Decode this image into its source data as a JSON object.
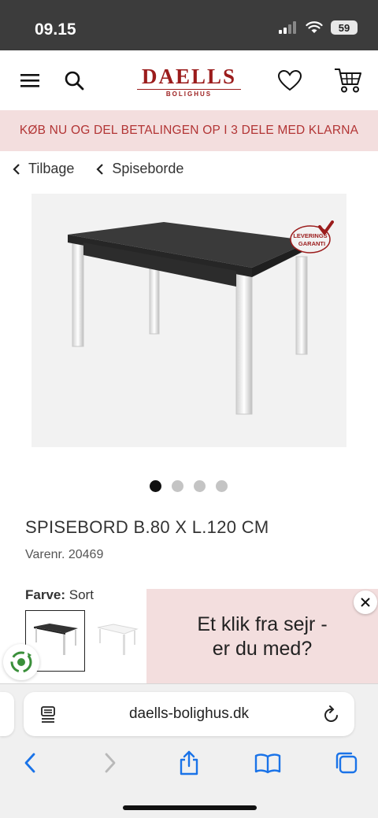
{
  "status_bar": {
    "time": "09.15",
    "battery": "59"
  },
  "header": {
    "logo_main": "DAELLS",
    "logo_sub": "BOLIGHUS",
    "icons": [
      "menu-icon",
      "search-icon",
      "heart-icon",
      "cart-icon"
    ]
  },
  "promo_banner": {
    "text": "KØB NU OG DEL BETALINGEN OP I 3 DELE MED KLARNA"
  },
  "breadcrumbs": [
    {
      "label": "Tilbage"
    },
    {
      "label": "Spiseborde"
    }
  ],
  "product": {
    "badge_line1": "LEVERINGS",
    "badge_line2": "GARANTI",
    "image_count": 4,
    "active_image": 1,
    "title": "SPISEBORD B.80 X L.120 CM",
    "sku": "Varenr. 20469",
    "color_label": "Farve:",
    "color_value": "Sort",
    "swatches": [
      "Sort",
      "Hvid"
    ]
  },
  "klarna_popup": {
    "line1": "Et klik fra sejr -",
    "line2": "er du med?"
  },
  "browser": {
    "url": "daells-bolighus.dk",
    "toolbar_icons": [
      "back-icon",
      "forward-icon",
      "share-icon",
      "bookmarks-icon",
      "tabs-icon"
    ]
  },
  "colors": {
    "brand": "#9b1c1c",
    "promo_bg": "#f3dede",
    "promo_text": "#b23434",
    "safari_blue": "#1a73e8"
  }
}
